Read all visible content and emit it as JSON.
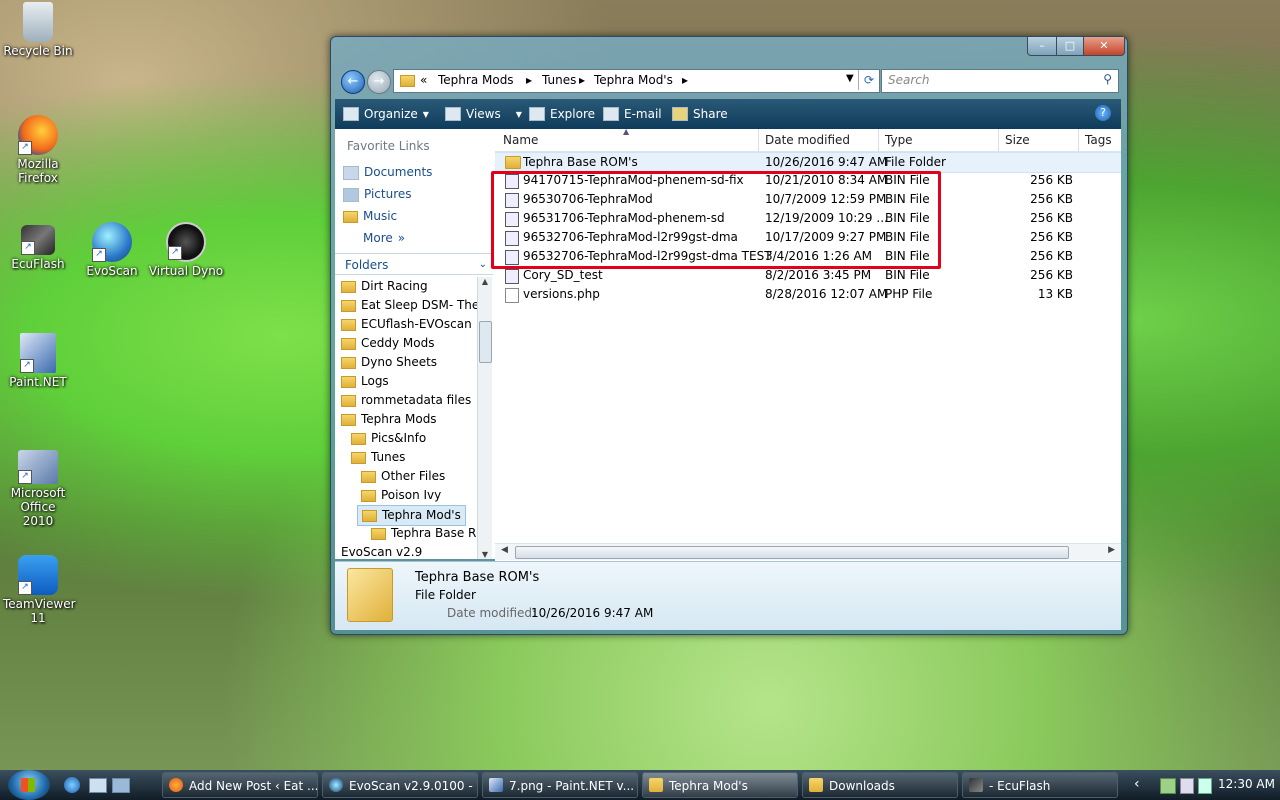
{
  "desktop": {
    "icons": [
      {
        "label": "Recycle Bin"
      },
      {
        "label": "Mozilla Firefox"
      },
      {
        "label": "EcuFlash"
      },
      {
        "label": "EvoScan"
      },
      {
        "label": "Virtual Dyno"
      },
      {
        "label": "Paint.NET"
      },
      {
        "label": "Microsoft Office 2010"
      },
      {
        "label": "TeamViewer 11"
      }
    ]
  },
  "explorer": {
    "window_controls": {
      "minimize": "–",
      "maximize": "□",
      "close": "✕"
    },
    "breadcrumb": [
      "«",
      "Tephra Mods",
      "Tunes",
      "Tephra Mod's"
    ],
    "search_placeholder": "Search",
    "toolbar": {
      "organize": "Organize",
      "views": "Views",
      "explore": "Explore",
      "email": "E-mail",
      "share": "Share"
    },
    "favorite_links": {
      "title": "Favorite Links",
      "items": [
        "Documents",
        "Pictures",
        "Music"
      ],
      "more": "More"
    },
    "folders_title": "Folders",
    "tree": [
      "Dirt Racing",
      "Eat Sleep DSM- The Boo",
      "ECUflash-EVOscan",
      "Ceddy Mods",
      "Dyno Sheets",
      "Logs",
      "rommetadata files",
      "Tephra Mods",
      "Pics&Info",
      "Tunes",
      "Other Files",
      "Poison Ivy",
      "Tephra Mod's",
      "Tephra Base ROM",
      "EvoScan v2.9"
    ],
    "columns": {
      "name": "Name",
      "date": "Date modified",
      "type": "Type",
      "size": "Size",
      "tags": "Tags"
    },
    "files": [
      {
        "name": "Tephra Base ROM's",
        "date": "10/26/2016 9:47 AM",
        "type": "File Folder",
        "size": ""
      },
      {
        "name": "94170715-TephraMod-phenem-sd-fix",
        "date": "10/21/2010 8:34 AM",
        "type": "BIN File",
        "size": "256 KB"
      },
      {
        "name": "96530706-TephraMod",
        "date": "10/7/2009 12:59 PM",
        "type": "BIN File",
        "size": "256 KB"
      },
      {
        "name": "96531706-TephraMod-phenem-sd",
        "date": "12/19/2009 10:29 ...",
        "type": "BIN File",
        "size": "256 KB"
      },
      {
        "name": "96532706-TephraMod-l2r99gst-dma",
        "date": "10/17/2009 9:27 PM",
        "type": "BIN File",
        "size": "256 KB"
      },
      {
        "name": "96532706-TephraMod-l2r99gst-dma TEST",
        "date": "3/4/2016 1:26 AM",
        "type": "BIN File",
        "size": "256 KB"
      },
      {
        "name": "Cory_SD_test",
        "date": "8/2/2016 3:45 PM",
        "type": "BIN File",
        "size": "256 KB"
      },
      {
        "name": "versions.php",
        "date": "8/28/2016 12:07 AM",
        "type": "PHP File",
        "size": "13 KB"
      }
    ],
    "details": {
      "name": "Tephra Base ROM's",
      "type": "File Folder",
      "date_label": "Date modified:",
      "date_value": "10/26/2016 9:47 AM"
    },
    "highlight_color": "#e3001b"
  },
  "taskbar": {
    "tasks": [
      {
        "label": "Add New Post ‹ Eat ..."
      },
      {
        "label": "EvoScan v2.9.0100 - ..."
      },
      {
        "label": "7.png - Paint.NET v..."
      },
      {
        "label": "Tephra Mod's"
      },
      {
        "label": "Downloads"
      },
      {
        "label": "- EcuFlash"
      }
    ],
    "clock": "12:30 AM",
    "tray_arrow": "‹"
  }
}
